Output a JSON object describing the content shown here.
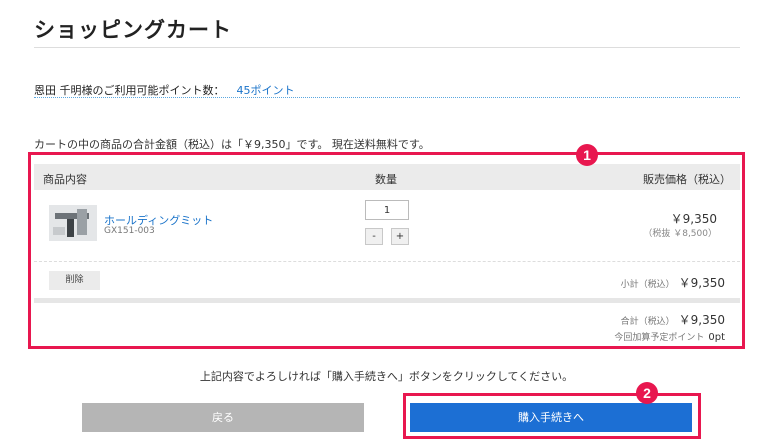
{
  "header": {
    "title": "ショッピングカート"
  },
  "points": {
    "label": "恩田 千明様のご利用可能ポイント数：",
    "value": "45ポイント"
  },
  "cart": {
    "summary": "カートの中の商品の合計金額（税込）は「￥9,350」です。 現在送料無料です。",
    "columns": {
      "product": "商品内容",
      "quantity": "数量",
      "price": "販売価格（税込）"
    },
    "items": [
      {
        "name": "ホールディングミット",
        "code": "GX151-003",
        "quantity": "1",
        "minus": "-",
        "plus": "+",
        "price": "￥9,350",
        "price_ex_tax": "（税抜 ￥8,500）"
      }
    ],
    "delete_label": "削除",
    "subtotal_label": "小計（税込）",
    "subtotal_value": "￥9,350",
    "total_label": "合計（税込）",
    "total_value": "￥9,350",
    "points_earned_label": "今回加算予定ポイント",
    "points_earned_value": "0pt"
  },
  "markers": {
    "one": "1",
    "two": "2"
  },
  "instruction": "上記内容でよろしければ「購入手続きへ」ボタンをクリックしてください。",
  "buttons": {
    "back": "戻る",
    "checkout": "購入手続きへ"
  },
  "colors": {
    "accent": "#e8174f",
    "primary": "#1c6fd4",
    "link": "#1a73c9"
  }
}
